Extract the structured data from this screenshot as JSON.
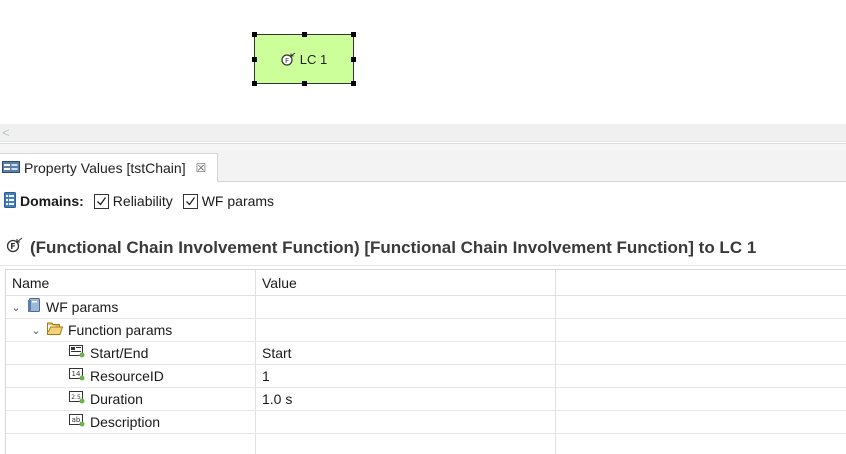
{
  "diagram": {
    "node_label": "LC 1",
    "node_color": "#ccff99"
  },
  "scrollbar": {
    "left_arrow": "<"
  },
  "view": {
    "tab_title": "Property Values [tstChain]",
    "tab_close": "☒",
    "icon": "property-view-icon"
  },
  "domains": {
    "label": "Domains:",
    "items": [
      {
        "label": "Reliability",
        "checked": true
      },
      {
        "label": "WF params",
        "checked": true
      }
    ]
  },
  "section": {
    "title": "(Functional Chain Involvement Function) [Functional Chain Involvement Function] to LC 1"
  },
  "table": {
    "headers": {
      "name": "Name",
      "value": "Value"
    },
    "rows": [
      {
        "name": "WF params",
        "value": "",
        "icon": "domain-book-icon",
        "twisty": "⌄"
      },
      {
        "name": "Function params",
        "value": "",
        "icon": "folder-open-icon",
        "twisty": "⌄"
      },
      {
        "name": "Start/End",
        "value": "Start",
        "icon": "enum-property-icon"
      },
      {
        "name": "ResourceID",
        "value": "1",
        "icon": "int-property-icon"
      },
      {
        "name": "Duration",
        "value": "1.0 s",
        "icon": "float-property-icon"
      },
      {
        "name": "Description",
        "value": "",
        "icon": "text-property-icon"
      }
    ]
  },
  "colors": {
    "accent_blue": "#3f7fbf",
    "folder": "#e8b84a"
  }
}
